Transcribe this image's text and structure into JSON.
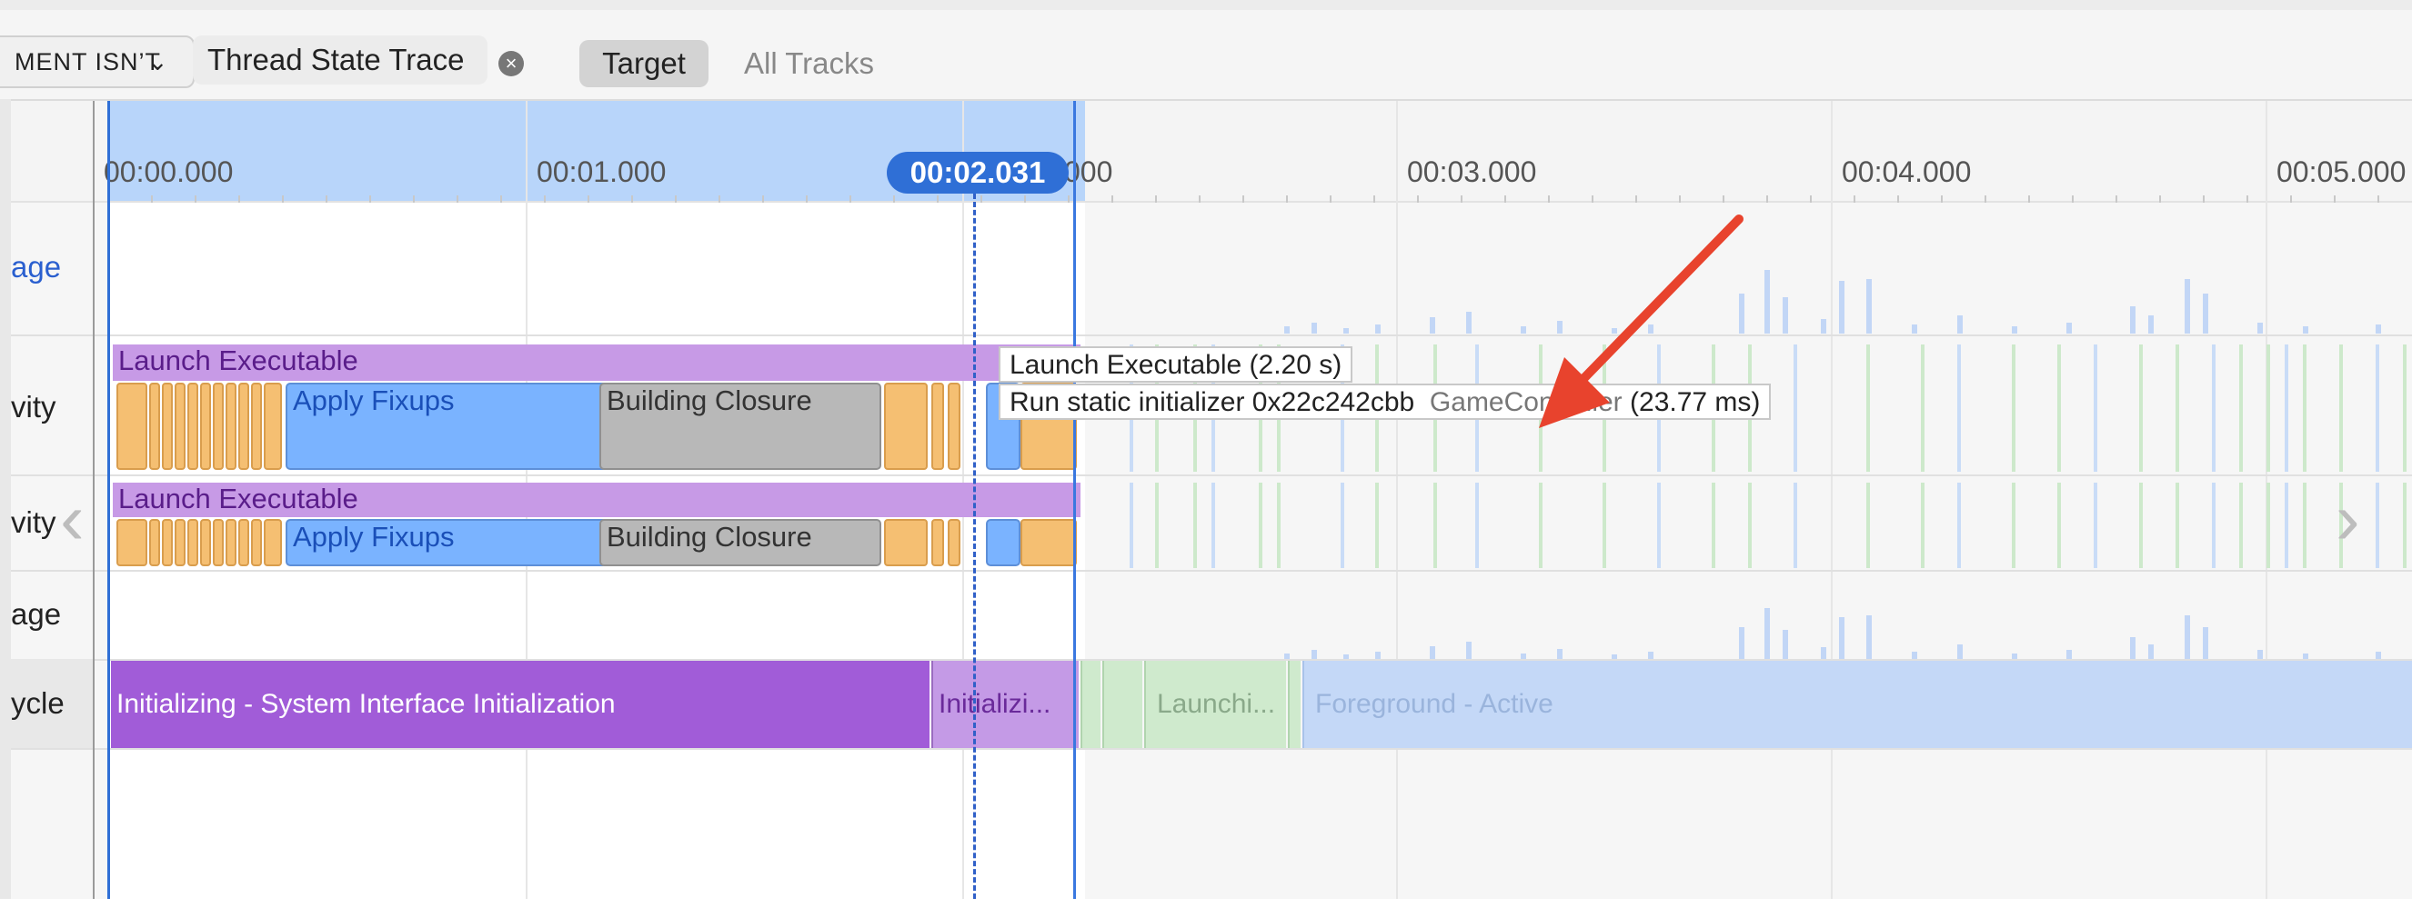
{
  "filter_bar": {
    "filter_token": "MENT ISN’T",
    "trace_token": "Thread State Trace",
    "clear_icon": "x-circle-icon",
    "target_button": "Target",
    "all_tracks_button": "All Tracks"
  },
  "ruler": {
    "ticks": [
      "00:00.000",
      "00:01.000",
      "000",
      "00:03.000",
      "00:04.000",
      "00:05.000"
    ],
    "playhead": "00:02.031"
  },
  "tracks": {
    "row1_label": "age",
    "row2_label": "vity",
    "row3_label": "vity",
    "row4_label": "age",
    "row5_label": "ycle"
  },
  "activity": {
    "launch": "Launch Executable",
    "fixups": "Apply Fixups",
    "closure": "Building Closure"
  },
  "lifecycle": {
    "system_init": "Initializing - System Interface Initialization",
    "initializing": "Initializi...",
    "launching": "Launchi...",
    "foreground": "Foreground - Active"
  },
  "tooltips": {
    "launch": "Launch Executable (2.20 s)",
    "static_init_prefix": "Run static initializer 0x22c242cbb",
    "static_init_class": "GameController",
    "static_init_duration": "(23.77 ms)"
  },
  "annotation": {
    "arrow_color": "#e8432d"
  },
  "colors": {
    "selection": "#b8d5fa",
    "playhead": "#2f6fd6",
    "launch_purple": "#c79ae6",
    "fixups_blue": "#7ab3ff",
    "closure_gray": "#b8b8b8"
  }
}
